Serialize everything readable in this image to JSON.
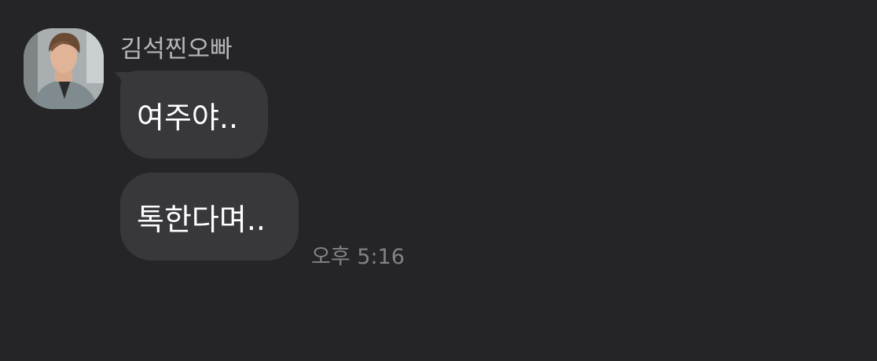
{
  "chat": {
    "sender_name": "김석찐오빠",
    "avatar": "profile-photo",
    "messages": [
      {
        "text": "여주야.."
      },
      {
        "text": "톡한다며.."
      }
    ],
    "timestamp": "오후 5:16"
  },
  "colors": {
    "background": "#252427",
    "bubble": "#38373b",
    "message_text": "#ffffff",
    "sender_text": "#b6b5b9",
    "time_text": "#838286"
  }
}
